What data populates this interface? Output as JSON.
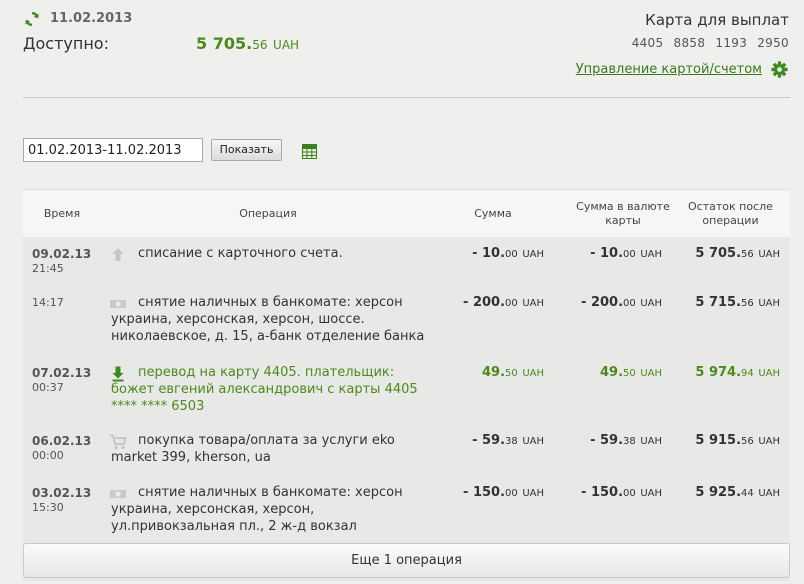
{
  "header": {
    "date": "11.02.2013",
    "available_label": "Доступно:",
    "available_int": "5 705.",
    "available_dec": "56",
    "available_cur": "UAH",
    "card_title": "Карта для выплат",
    "card_number": "4405 8858 1193 2950",
    "manage_link": "Управление картой/счетом",
    "accent": "#4a8a1c"
  },
  "filter": {
    "range_value": "01.02.2013-11.02.2013",
    "show_label": "Показать"
  },
  "table": {
    "headers": {
      "time": "Время",
      "operation": "Операция",
      "sum": "Сумма",
      "currency_sum_line1": "Сумма в валюте",
      "currency_sum_line2": "карты",
      "balance_line1": "Остаток после",
      "balance_line2": "операции"
    },
    "rows": [
      {
        "date": "09.02.13",
        "time": "21:45",
        "icon": "upload-arrow-icon",
        "green": false,
        "text": "списание с карточного счета.",
        "sum_int": "- 10.",
        "sum_dec": "00",
        "cur_int": "- 10.",
        "cur_dec": "00",
        "bal_int": "5 705.",
        "bal_dec": "56",
        "currency": "UAH"
      },
      {
        "date": "",
        "time": "14:17",
        "icon": "cash-icon",
        "green": false,
        "text": "снятие наличных в банкомате: херсон украина, херсонская, херсон, шоссе. николаевское, д. 15, а-банк отделение банка",
        "sum_int": "- 200.",
        "sum_dec": "00",
        "cur_int": "- 200.",
        "cur_dec": "00",
        "bal_int": "5 715.",
        "bal_dec": "56",
        "currency": "UAH"
      },
      {
        "date": "07.02.13",
        "time": "00:37",
        "icon": "download-arrow-icon",
        "green": true,
        "text": "перевод на карту 4405. плательщик: божет евгений александрович с карты 4405 **** **** 6503",
        "sum_int": "49.",
        "sum_dec": "50",
        "cur_int": "49.",
        "cur_dec": "50",
        "bal_int": "5 974.",
        "bal_dec": "94",
        "currency": "UAH"
      },
      {
        "date": "06.02.13",
        "time": "00:00",
        "icon": "cart-icon",
        "green": false,
        "text": "покупка товара/оплата за услуги eko market 399, kherson, ua",
        "sum_int": "- 59.",
        "sum_dec": "38",
        "cur_int": "- 59.",
        "cur_dec": "38",
        "bal_int": "5 915.",
        "bal_dec": "56",
        "currency": "UAH"
      },
      {
        "date": "03.02.13",
        "time": "15:30",
        "icon": "cash-icon",
        "green": false,
        "text": "снятие наличных в банкомате: херсон украина, херсонская, херсон, ул.привокзальная пл., 2 ж-д вокзал",
        "sum_int": "- 150.",
        "sum_dec": "00",
        "cur_int": "- 150.",
        "cur_dec": "00",
        "bal_int": "5 925.",
        "bal_dec": "44",
        "currency": "UAH"
      }
    ],
    "more_label": "Еще 1 операция"
  }
}
